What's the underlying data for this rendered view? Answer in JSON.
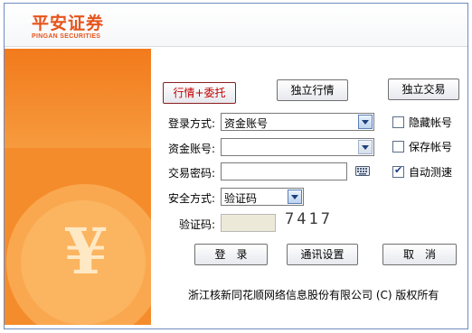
{
  "brand": {
    "name_cn": "平安证券",
    "name_en": "PINGAN SECURITIES"
  },
  "mode_buttons": {
    "quote_trade": "行情+委托",
    "quote_only": "独立行情",
    "trade_only": "独立交易"
  },
  "form": {
    "login_method": {
      "label": "登录方式:",
      "value": "资金账号"
    },
    "account": {
      "label": "资金账号:",
      "value": ""
    },
    "password": {
      "label": "交易密码:",
      "value": ""
    },
    "security_method": {
      "label": "安全方式:",
      "value": "验证码"
    },
    "captcha": {
      "label": "验证码:",
      "value": "",
      "image_text": "7417"
    }
  },
  "options": {
    "hide_account": {
      "label": "隐藏帐号",
      "checked": false
    },
    "save_account": {
      "label": "保存帐号",
      "checked": false
    },
    "auto_speed_test": {
      "label": "自动测速",
      "checked": true
    }
  },
  "actions": {
    "login": "登　录",
    "comm_settings": "通讯设置",
    "cancel": "取　消"
  },
  "footer": {
    "copyright": "浙江核新同花顺网络信息股份有限公司 (C) 版权所有"
  },
  "icons": {
    "keyboard": "keyboard-icon",
    "yen": "yen-icon",
    "dropdown": "chevron-down-icon"
  },
  "colors": {
    "brand_orange": "#e7531c",
    "panel_orange": "#f58c2c",
    "window_border": "#6d8cc0",
    "active_text": "#c00000"
  }
}
